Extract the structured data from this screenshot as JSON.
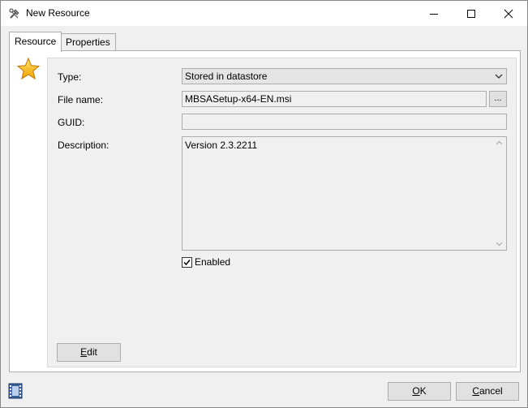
{
  "window": {
    "title": "New Resource"
  },
  "tabs": [
    {
      "label": "Resource",
      "active": true
    },
    {
      "label": "Properties",
      "active": false
    }
  ],
  "form": {
    "type_label": "Type:",
    "type_value": "Stored in datastore",
    "filename_label": "File name:",
    "filename_value": "MBSASetup-x64-EN.msi",
    "browse_label": "...",
    "guid_label": "GUID:",
    "guid_value": "",
    "description_label": "Description:",
    "description_value": "Version 2.3.2211",
    "enabled_label": "Enabled",
    "enabled_checked": true
  },
  "buttons": {
    "edit_mnemonic": "E",
    "edit_rest": "dit",
    "ok_mnemonic": "O",
    "ok_rest": "K",
    "cancel_mnemonic": "C",
    "cancel_rest": "ancel"
  },
  "colors": {
    "accent_star": "#f5b400",
    "window_bg": "#f0f0f0"
  },
  "icons": {
    "app": "tools-icon",
    "tab_icon": "star-icon",
    "footer": "film-strip-icon"
  }
}
